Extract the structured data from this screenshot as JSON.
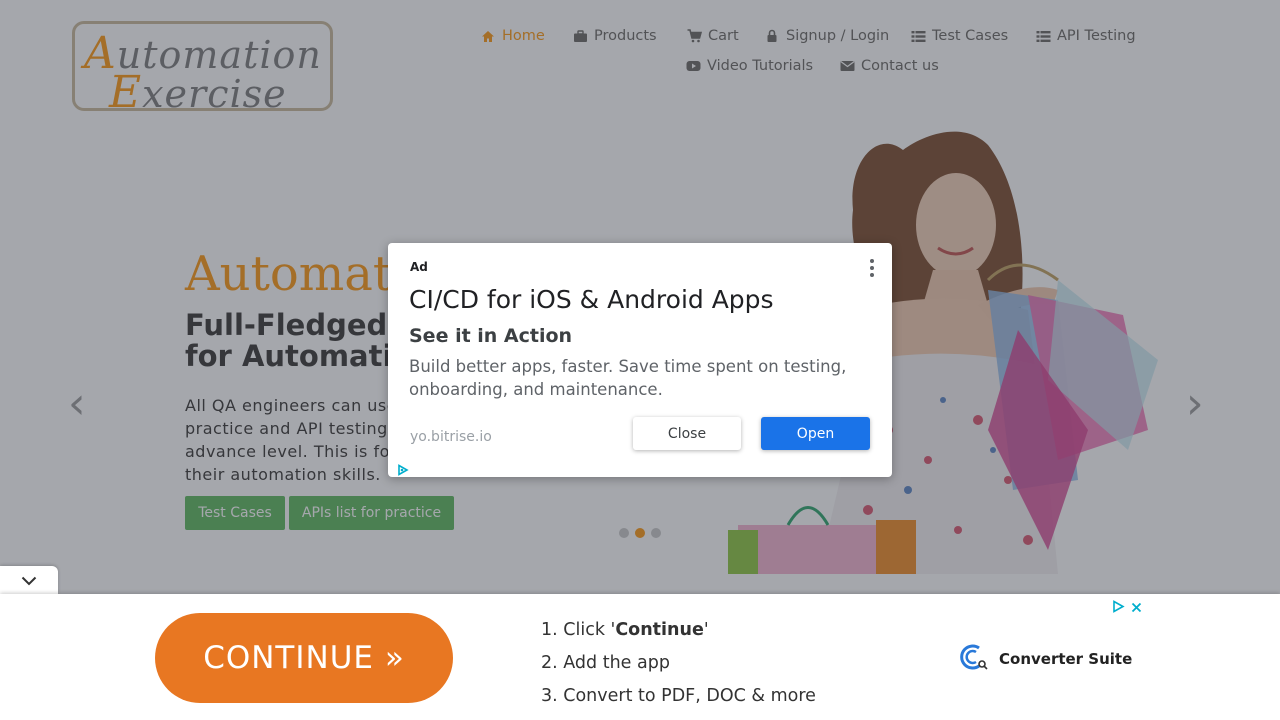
{
  "header": {
    "logo": {
      "line1_cap": "A",
      "line1_rest": "utomation",
      "line2_cap": "E",
      "line2_rest": "xercise"
    },
    "nav": [
      {
        "label": "Home",
        "icon": "home-icon"
      },
      {
        "label": "Products",
        "icon": "briefcase-icon"
      },
      {
        "label": "Cart",
        "icon": "cart-icon"
      },
      {
        "label": "Signup / Login",
        "icon": "lock-icon"
      },
      {
        "label": "Test Cases",
        "icon": "list-icon"
      },
      {
        "label": "API Testing",
        "icon": "list-icon"
      },
      {
        "label": "Video Tutorials",
        "icon": "youtube-icon"
      },
      {
        "label": "Contact us",
        "icon": "envelope-icon"
      }
    ]
  },
  "hero": {
    "title": "Automat",
    "subtitle_line1": "Full-Fledged",
    "subtitle_line2": "for Automatio",
    "text_lines": [
      "All QA engineers can use",
      "practice and API testing e",
      "advance level. This is for",
      "their automation skills."
    ],
    "buttons": [
      "Test Cases",
      "APIs list for practice"
    ],
    "prev_arrow": "‹",
    "next_arrow": "›"
  },
  "ad_modal": {
    "label": "Ad",
    "headline": "CI/CD for iOS & Android Apps",
    "subheadline": "See it in Action",
    "description": "Build better apps, faster. Save time spent on testing, onboarding, and maintenance.",
    "url": "yo.bitrise.io",
    "close_label": "Close",
    "open_label": "Open"
  },
  "bottom_ad": {
    "continue_label": "CONTINUE »",
    "steps": [
      {
        "prefix": "1. Click '",
        "bold": "Continue",
        "suffix": "'"
      },
      {
        "prefix": "2. Add the app",
        "bold": "",
        "suffix": ""
      },
      {
        "prefix": "3. Convert to PDF, DOC & more",
        "bold": "",
        "suffix": ""
      }
    ],
    "brand": "Converter Suite"
  },
  "colors": {
    "accent": "#fe980f",
    "green": "#5cb85c",
    "open_blue": "#1a73e8",
    "continue_orange": "#e87722"
  }
}
